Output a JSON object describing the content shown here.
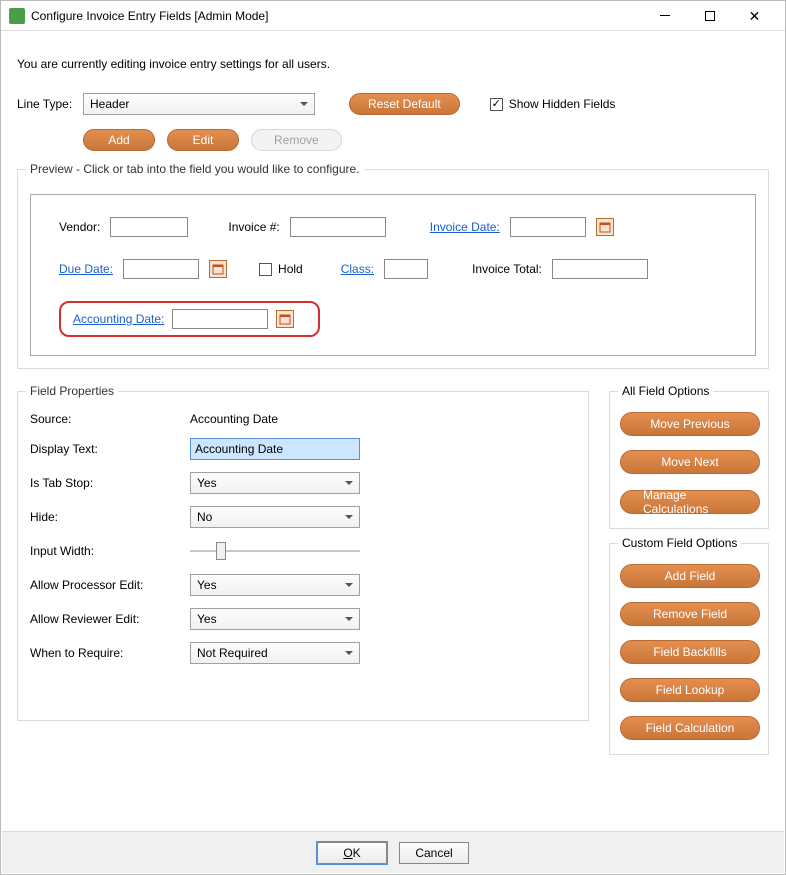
{
  "window": {
    "title": "Configure Invoice Entry Fields [Admin Mode]"
  },
  "intro": "You are currently editing invoice entry settings for all users.",
  "line_type": {
    "label": "Line Type:",
    "value": "Header"
  },
  "actions": {
    "reset_default": "Reset Default",
    "add": "Add",
    "edit": "Edit",
    "remove": "Remove",
    "show_hidden_label": "Show Hidden Fields"
  },
  "preview": {
    "legend": "Preview - Click or tab into the field you would like to configure.",
    "vendor_label": "Vendor:",
    "invoice_num_label": "Invoice #:",
    "invoice_date_label": "Invoice Date:",
    "due_date_label": "Due Date:",
    "hold_label": "Hold",
    "class_label": "Class:",
    "invoice_total_label": "Invoice Total:",
    "accounting_date_label": "Accounting Date:"
  },
  "field_properties": {
    "legend": "Field Properties",
    "source_label": "Source:",
    "source_value": "Accounting Date",
    "display_text_label": "Display Text:",
    "display_text_value": "Accounting Date",
    "is_tab_stop_label": "Is Tab Stop:",
    "is_tab_stop_value": "Yes",
    "hide_label": "Hide:",
    "hide_value": "No",
    "input_width_label": "Input Width:",
    "input_width_percent": 18,
    "allow_processor_label": "Allow Processor Edit:",
    "allow_processor_value": "Yes",
    "allow_reviewer_label": "Allow Reviewer Edit:",
    "allow_reviewer_value": "Yes",
    "when_require_label": "When to Require:",
    "when_require_value": "Not Required"
  },
  "all_field_options": {
    "legend": "All Field Options",
    "move_previous": "Move Previous",
    "move_next": "Move Next",
    "manage_calculations": "Manage Calculations"
  },
  "custom_field_options": {
    "legend": "Custom Field Options",
    "add_field": "Add Field",
    "remove_field": "Remove Field",
    "field_backfills": "Field Backfills",
    "field_lookup": "Field Lookup",
    "field_calculation": "Field Calculation"
  },
  "footer": {
    "ok": "OK",
    "cancel": "Cancel"
  }
}
